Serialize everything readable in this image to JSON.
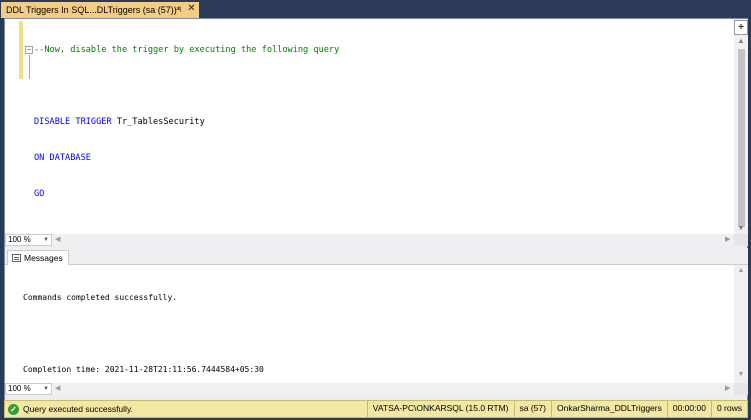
{
  "tab": {
    "title": "DDL Triggers In SQL...DLTriggers (sa (57))*",
    "pin_icon": "pin-icon",
    "close_icon": "close-icon"
  },
  "editor": {
    "line1": "--Now, disable the trigger by executing the following query",
    "line3_kw": "DISABLE TRIGGER",
    "line3_ident": " Tr_TablesSecurity",
    "line4": "ON DATABASE",
    "line5": "GO",
    "zoom": "100 %"
  },
  "results": {
    "tab_label": "Messages",
    "line1": "Commands completed successfully.",
    "line2": "",
    "line3": "Completion time: 2021-11-28T21:11:56.7444584+05:30",
    "zoom": "100 %"
  },
  "status": {
    "message": "Query executed successfully.",
    "server": "VATSA-PC\\ONKARSQL (15.0 RTM)",
    "user": "sa (57)",
    "database": "OnkarSharma_DDLTriggers",
    "elapsed": "00:00:00",
    "rows": "0 rows"
  },
  "colors": {
    "tab_active": "#f5cc84",
    "statusbar": "#f2e7a3",
    "comment": "#008000",
    "keyword": "#0000ff"
  }
}
